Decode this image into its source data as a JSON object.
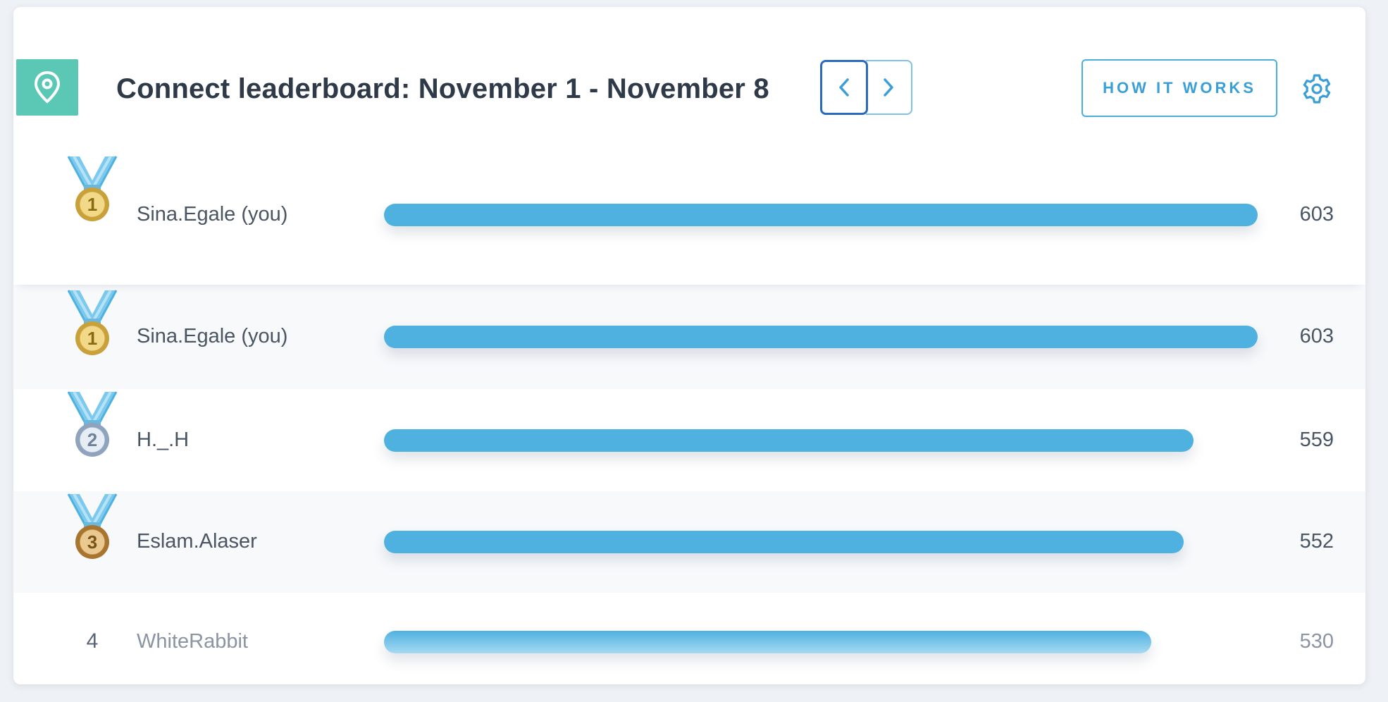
{
  "header": {
    "title": "Connect leaderboard: November 1 - November 8",
    "how_it_works_label": "HOW IT WORKS",
    "icons": {
      "pin": "location-pin-icon",
      "prev": "chevron-left-icon",
      "next": "chevron-right-icon",
      "settings": "gear-icon"
    }
  },
  "colors": {
    "accent": "#4fb1e0",
    "pin_badge": "#5bc8b6",
    "gold": "#e9c45a",
    "silver": "#8fa3bd",
    "bronze": "#c99a4e"
  },
  "current_user": {
    "rank": 1,
    "medal": "gold",
    "name": "Sina.Egale (you)",
    "score": "603",
    "progress": 1.0
  },
  "leaderboard": [
    {
      "rank": 1,
      "medal": "gold",
      "name": "Sina.Egale (you)",
      "score": "603",
      "progress": 1.0
    },
    {
      "rank": 2,
      "medal": "silver",
      "name": "H._.H",
      "score": "559",
      "progress": 0.927
    },
    {
      "rank": 3,
      "medal": "bronze",
      "name": "Eslam.Alaser",
      "score": "552",
      "progress": 0.915
    },
    {
      "rank": 4,
      "medal": null,
      "rank_label": "4",
      "name": "WhiteRabbit",
      "score": "530",
      "progress": 0.878
    }
  ]
}
